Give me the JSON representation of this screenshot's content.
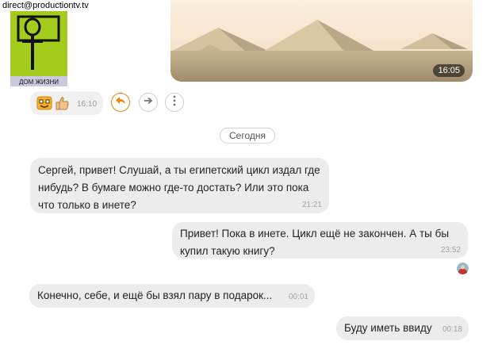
{
  "header": {
    "email": "direct@productiontv.tv",
    "logo_caption": "ДОМ ЖИЗНИ"
  },
  "photo_message": {
    "time": "16:05"
  },
  "reaction_message": {
    "time": "16:10"
  },
  "actions": {
    "reply_icon": "reply-arrow-icon",
    "forward_icon": "forward-arrow-icon",
    "more_icon": "vertical-dots-icon"
  },
  "date_separator": "Сегодня",
  "messages": [
    {
      "text": "Сергей, привет! Слушай, а ты египетский цикл издал где нибудь? В бумаге можно где-то достать? Или это пока что только в инете?",
      "time": "21:21"
    },
    {
      "text": "Привет! Пока в инете. Цикл ещё не закончен. А ты бы купил такую книгу?",
      "time": "23:52"
    },
    {
      "text": "Конечно, себе, и ещё бы взял пару в подарок...",
      "time": "00:01"
    },
    {
      "text": "Буду иметь ввиду",
      "time": "00:18"
    }
  ],
  "colors": {
    "accent": "#ee8208",
    "bubble": "#ececec",
    "logo_bg": "#a4cc1c"
  }
}
